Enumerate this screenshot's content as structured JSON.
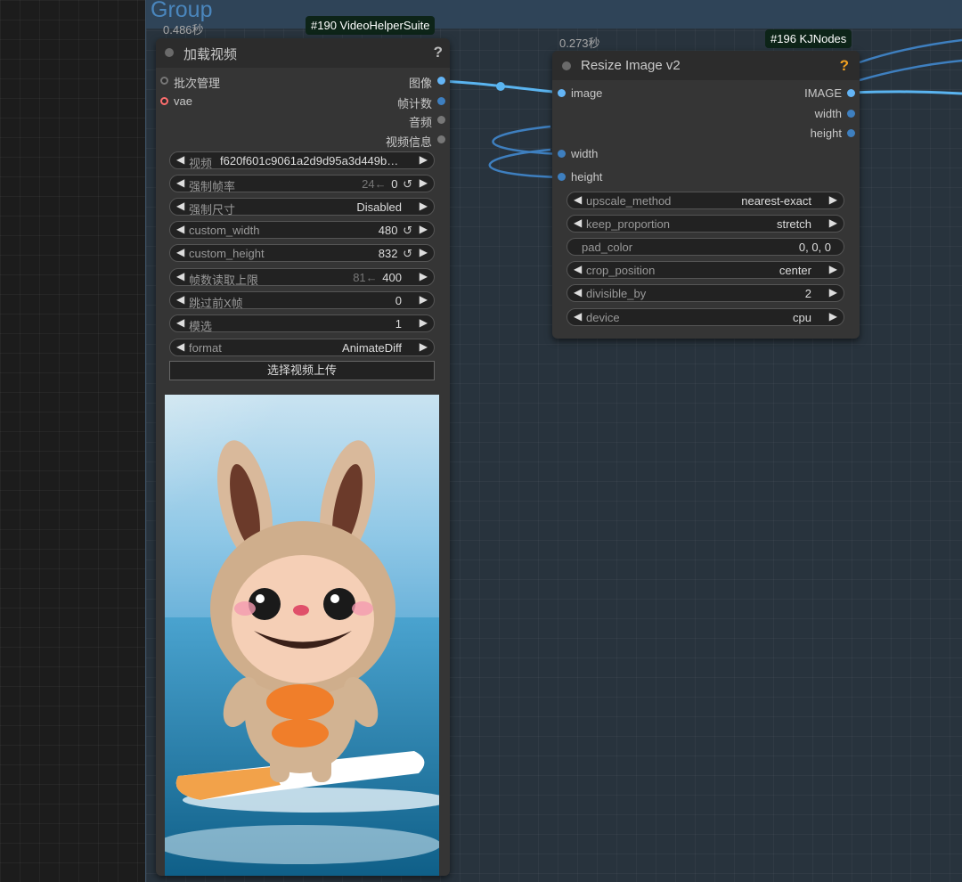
{
  "group": {
    "title": "Group"
  },
  "load_video_node": {
    "exec_time": "0.486秒",
    "badge": "#190 VideoHelperSuite",
    "title": "加载视频",
    "help": "?",
    "inputs": [
      "批次管理",
      "vae"
    ],
    "outputs": [
      "图像",
      "帧计数",
      "音频",
      "视频信息"
    ],
    "widgets": [
      {
        "label": "视频",
        "value": "f620f601c9061a2d9d95a3d449b…",
        "sub": "",
        "reset": ""
      },
      {
        "label": "强制帧率",
        "value": "0",
        "sub": "24←",
        "reset": "↺"
      },
      {
        "label": "强制尺寸",
        "value": "Disabled",
        "sub": "",
        "reset": ""
      },
      {
        "label": "custom_width",
        "value": "480",
        "sub": "",
        "reset": "↺"
      },
      {
        "label": "custom_height",
        "value": "832",
        "sub": "",
        "reset": "↺"
      },
      {
        "label": "帧数读取上限",
        "value": "400",
        "sub": "81←",
        "reset": ""
      },
      {
        "label": "跳过前X帧",
        "value": "0",
        "sub": "",
        "reset": ""
      },
      {
        "label": "模选",
        "value": "1",
        "sub": "",
        "reset": ""
      },
      {
        "label": "format",
        "value": "AnimateDiff",
        "sub": "",
        "reset": ""
      }
    ],
    "upload_button": "选择视频上传"
  },
  "resize_node": {
    "exec_time": "0.273秒",
    "badge": "#196 KJNodes",
    "title": "Resize Image v2",
    "help": "?",
    "inputs": [
      "image",
      "width",
      "height"
    ],
    "outputs": [
      "IMAGE",
      "width",
      "height"
    ],
    "widgets": [
      {
        "label": "upscale_method",
        "value": "nearest-exact",
        "arrows": true
      },
      {
        "label": "keep_proportion",
        "value": "stretch",
        "arrows": true
      },
      {
        "label": "pad_color",
        "value": "0, 0, 0",
        "arrows": false
      },
      {
        "label": "crop_position",
        "value": "center",
        "arrows": true
      },
      {
        "label": "divisible_by",
        "value": "2",
        "arrows": true
      },
      {
        "label": "device",
        "value": "cpu",
        "arrows": true
      }
    ]
  },
  "colors": {
    "link_blue": "#5ab4f0",
    "slot_image": "#64b5f6",
    "slot_int": "#3e7fbf",
    "slot_audio": "#777777",
    "slot_vae": "#ff6e6e",
    "badge_bg": "#0d2418",
    "help_orange": "#f0a020"
  }
}
